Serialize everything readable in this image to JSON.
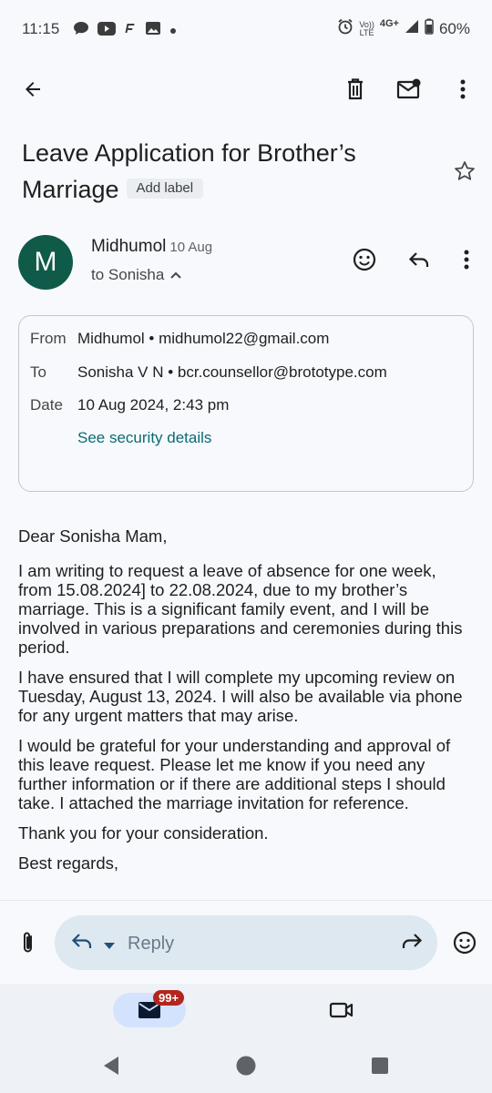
{
  "status_bar": {
    "time": "11:15",
    "battery": "60%",
    "network": "4G+",
    "volte": "Vo))\nLTE"
  },
  "subject": {
    "title": "Leave Application for Brother’s Marriage",
    "add_label": "Add label"
  },
  "sender": {
    "initial": "M",
    "name": "Midhumol",
    "date": "10 Aug",
    "recipient": "to Sonisha",
    "avatar_color": "#0f5a49"
  },
  "details": {
    "from_label": "From",
    "from_value": "Midhumol • midhumol22@gmail.com",
    "to_label": "To",
    "to_value": "Sonisha V N • bcr.counsellor@brototype.com",
    "date_label": "Date",
    "date_value": "10 Aug 2024, 2:43 pm",
    "security_link": "See security details"
  },
  "body": {
    "greeting": "Dear Sonisha Mam,",
    "para1": "I am writing to request a leave of absence for one week, from 15.08.2024] to 22.08.2024, due to my brother’s marriage. This is a significant family event, and I will be involved in various preparations and ceremonies during this period.",
    "para2": "I have ensured that I will complete my upcoming review on Tuesday, August 13, 2024. I will also be available via phone for any urgent matters that may arise.",
    "para3": "I would be grateful for your understanding and approval of this leave request. Please let me know if you need any further information or if there are additional steps I should take. I attached the marriage invitation for reference.",
    "thanks": "Thank you for your consideration.",
    "closing": "Best regards,"
  },
  "reply": {
    "placeholder": "Reply"
  },
  "bottom_nav": {
    "mail_badge": "99+"
  }
}
